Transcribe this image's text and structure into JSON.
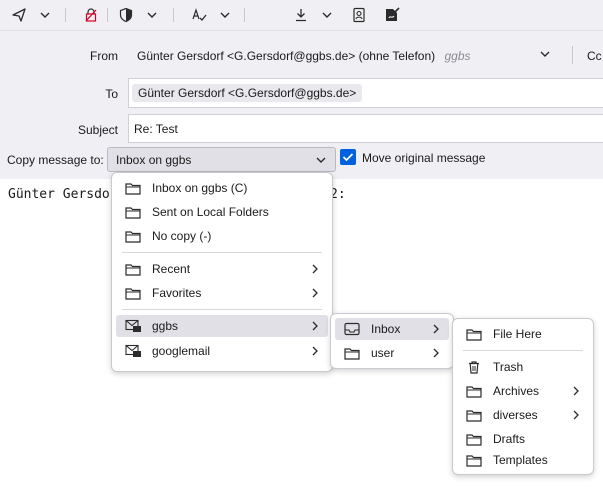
{
  "header": {
    "from_label": "From",
    "from_value": "Günter Gersdorf <G.Gersdorf@ggbs.de> (ohne Telefon)",
    "from_identity": "ggbs",
    "cc_label": "Cc",
    "to_label": "To",
    "to_recipient": "Günter Gersdorf <G.Gersdorf@ggbs.de>",
    "subject_label": "Subject",
    "subject_value": "Re: Test",
    "copy_label": "Copy message to:",
    "copy_select_value": "Inbox on ggbs",
    "move_label": "Move original message",
    "move_checked": true
  },
  "body": {
    "text_left": "Günter Gersdo",
    "text_right": "2:"
  },
  "copy_menu": {
    "items": [
      {
        "label": "Inbox on ggbs (C)",
        "icon": "folder-icon"
      },
      {
        "label": "Sent on Local Folders",
        "icon": "folder-icon"
      },
      {
        "label": "No copy (-)",
        "icon": "folder-icon"
      },
      {
        "label": "Recent",
        "icon": "folder-icon"
      },
      {
        "label": "Favorites",
        "icon": "folder-icon"
      },
      {
        "label": "ggbs",
        "icon": "mail-account-icon"
      },
      {
        "label": "googlemail",
        "icon": "mail-account-icon"
      }
    ]
  },
  "account_menu": {
    "items": [
      {
        "label": "Inbox",
        "icon": "inbox-icon"
      },
      {
        "label": "user",
        "icon": "folder-icon"
      }
    ]
  },
  "inbox_menu": {
    "items": [
      {
        "label": "File Here",
        "icon": "folder-icon"
      },
      {
        "label": "Trash",
        "icon": "trash-icon"
      },
      {
        "label": "Archives",
        "icon": "folder-icon"
      },
      {
        "label": "diverses",
        "icon": "folder-icon"
      },
      {
        "label": "Drafts",
        "icon": "folder-icon"
      },
      {
        "label": "Templates",
        "icon": "folder-icon"
      }
    ]
  },
  "colors": {
    "toolbar_bg": "#f0f0f4",
    "checkbox_accent": "#0061e0",
    "highlight": "#e0e0e6"
  }
}
